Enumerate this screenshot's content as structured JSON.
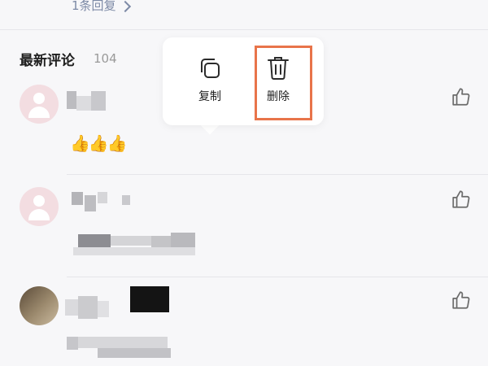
{
  "top": {
    "reply_link": "1条回复"
  },
  "section": {
    "title": "最新评论",
    "count": "104"
  },
  "context_menu": {
    "items": [
      {
        "label": "复制",
        "icon": "copy-icon"
      },
      {
        "label": "删除",
        "icon": "trash-icon"
      }
    ]
  },
  "comments": [
    {
      "emoji": "👍👍👍"
    },
    {},
    {}
  ],
  "colors": {
    "highlight": "#e8744a",
    "link": "#7d8aa6"
  }
}
